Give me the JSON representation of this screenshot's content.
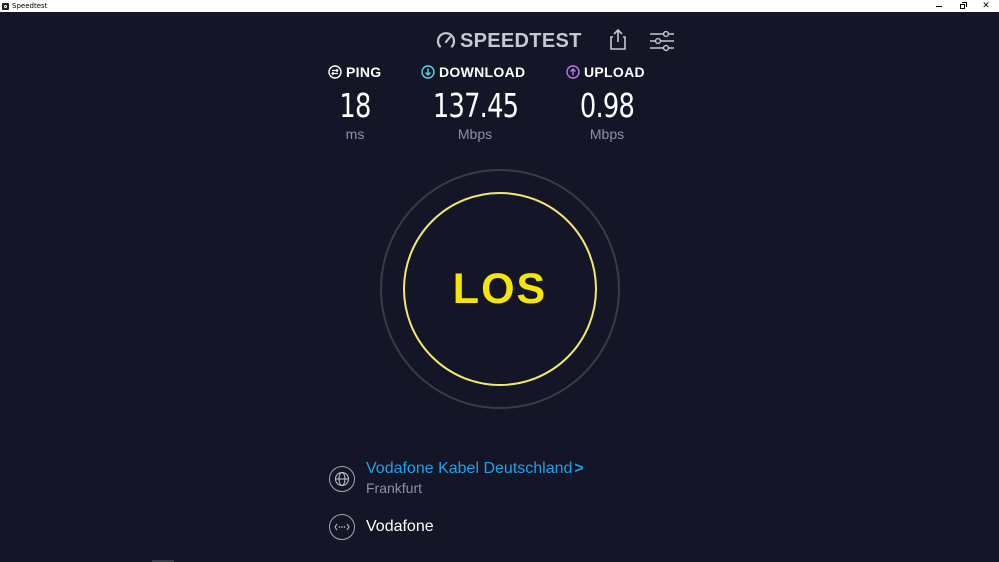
{
  "window": {
    "title": "Speedtest"
  },
  "header": {
    "logo_text": "SPEEDTEST",
    "share_icon": "share-icon",
    "settings_icon": "settings-icon"
  },
  "metrics": {
    "ping": {
      "label": "PING",
      "value": "18",
      "unit": "ms",
      "icon": "ping-icon",
      "color": "#ffffff"
    },
    "download": {
      "label": "DOWNLOAD",
      "value": "137.45",
      "unit": "Mbps",
      "icon": "download-arrow-icon",
      "color": "#5bd4e6"
    },
    "upload": {
      "label": "UPLOAD",
      "value": "0.98",
      "unit": "Mbps",
      "icon": "upload-arrow-icon",
      "color": "#b77ee3"
    }
  },
  "go_button": {
    "label": "LOS",
    "color": "#f6e600"
  },
  "provider": {
    "name": "Vodafone Kabel Deutschland",
    "chevron": ">",
    "location": "Frankfurt",
    "icon": "globe-icon",
    "color": "#1fa3e8"
  },
  "server": {
    "name": "Vodafone",
    "icon": "server-icon"
  },
  "colors": {
    "background": "#141526",
    "muted_text": "#8e90a6",
    "ring": "#3a3b47"
  }
}
